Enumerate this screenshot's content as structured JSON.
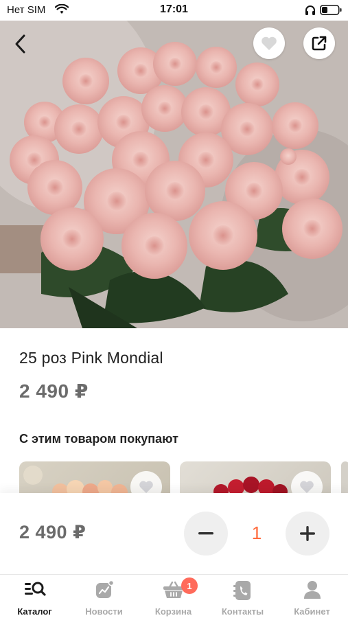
{
  "status_bar": {
    "carrier": "Нет SIM",
    "time": "17:01"
  },
  "product": {
    "title": "25 роз Pink Mondial",
    "price": "2 490 ₽",
    "image": "pink-roses-bouquet-photo"
  },
  "related": {
    "title": "С этим товаром покупают",
    "items": [
      {
        "image": "peach-roses-photo"
      },
      {
        "image": "red-roses-photo"
      }
    ]
  },
  "purchase_bar": {
    "price": "2 490 ₽",
    "quantity": "1"
  },
  "tabs": [
    {
      "label": "Каталог",
      "icon": "catalog-search-icon",
      "active": true
    },
    {
      "label": "Новости",
      "icon": "news-chart-icon"
    },
    {
      "label": "Корзина",
      "icon": "basket-icon",
      "badge": "1"
    },
    {
      "label": "Контакты",
      "icon": "phone-contacts-icon"
    },
    {
      "label": "Кабинет",
      "icon": "user-icon"
    }
  ],
  "colors": {
    "accent": "#ff6b3d",
    "badge": "#ff6b5b",
    "price_gray": "#6b6b6b",
    "inactive_tab": "#a9a9a9"
  }
}
